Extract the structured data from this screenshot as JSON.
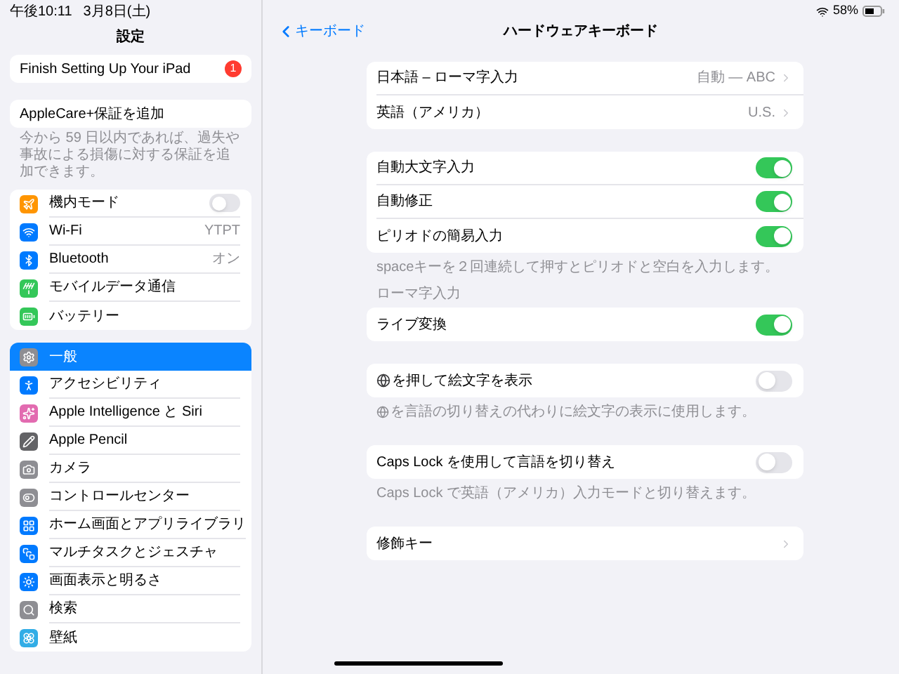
{
  "status_bar": {
    "time": "午後10:11",
    "date": "3月8日(土)",
    "battery": "58%"
  },
  "sidebar": {
    "title": "設定",
    "setup_item": {
      "label": "Finish Setting Up Your iPad",
      "badge": "1"
    },
    "applecare": {
      "label": "AppleCare+保証を追加",
      "footer": "今から 59 日以内であれば、過失や事故による損傷に対する保証を追加できます。"
    },
    "groups": [
      [
        {
          "label": "機内モード",
          "kind": "toggle",
          "on": false,
          "selected": false
        },
        {
          "label": "Wi-Fi",
          "kind": "value",
          "value": "YTPT",
          "selected": false
        },
        {
          "label": "Bluetooth",
          "kind": "value",
          "value": "オン",
          "selected": false
        },
        {
          "label": "モバイルデータ通信",
          "kind": "plain",
          "selected": false
        },
        {
          "label": "バッテリー",
          "kind": "plain",
          "selected": false
        }
      ],
      [
        {
          "label": "一般",
          "kind": "plain",
          "selected": true
        },
        {
          "label": "アクセシビリティ",
          "kind": "plain",
          "selected": false
        },
        {
          "label": "Apple Intelligence と Siri",
          "kind": "plain",
          "selected": false
        },
        {
          "label": "Apple Pencil",
          "kind": "plain",
          "selected": false
        },
        {
          "label": "カメラ",
          "kind": "plain",
          "selected": false
        },
        {
          "label": "コントロールセンター",
          "kind": "plain",
          "selected": false
        },
        {
          "label": "ホーム画面とアプリライブラリ",
          "kind": "plain",
          "selected": false
        },
        {
          "label": "マルチタスクとジェスチャ",
          "kind": "plain",
          "selected": false
        },
        {
          "label": "画面表示と明るさ",
          "kind": "plain",
          "selected": false
        },
        {
          "label": "検索",
          "kind": "plain",
          "selected": false
        },
        {
          "label": "壁紙",
          "kind": "plain",
          "selected": false
        }
      ]
    ]
  },
  "detail": {
    "back_label": "キーボード",
    "title": "ハードウェアキーボード",
    "sections": [
      {
        "rows": [
          {
            "label": "日本語 – ローマ字入力",
            "kind": "value",
            "value": "自動 — ABC"
          },
          {
            "label": "英語（アメリカ）",
            "kind": "value",
            "value": "U.S."
          }
        ]
      },
      {
        "rows": [
          {
            "label": "自動大文字入力",
            "kind": "toggle",
            "on": true
          },
          {
            "label": "自動修正",
            "kind": "toggle",
            "on": true
          },
          {
            "label": "ピリオドの簡易入力",
            "kind": "toggle",
            "on": true
          }
        ],
        "footer": "spaceキーを２回連続して押すとピリオドと空白を入力します。"
      },
      {
        "header": "ローマ字入力",
        "rows": [
          {
            "label": "ライブ変換",
            "kind": "toggle",
            "on": true
          }
        ]
      },
      {
        "rows": [
          {
            "label": "を押して絵文字を表示",
            "kind": "toggle",
            "on": false,
            "prefix_icon": true
          }
        ],
        "footer": "を言語の切り替えの代わりに絵文字の表示に使用します。",
        "footer_prefix_icon": true
      },
      {
        "rows": [
          {
            "label": "Caps Lock を使用して言語を切り替え",
            "kind": "toggle",
            "on": false
          }
        ],
        "footer": "Caps Lock で英語（アメリカ）入力モードと切り替えます。"
      },
      {
        "rows": [
          {
            "label": "修飾キー",
            "kind": "link"
          }
        ]
      }
    ]
  }
}
